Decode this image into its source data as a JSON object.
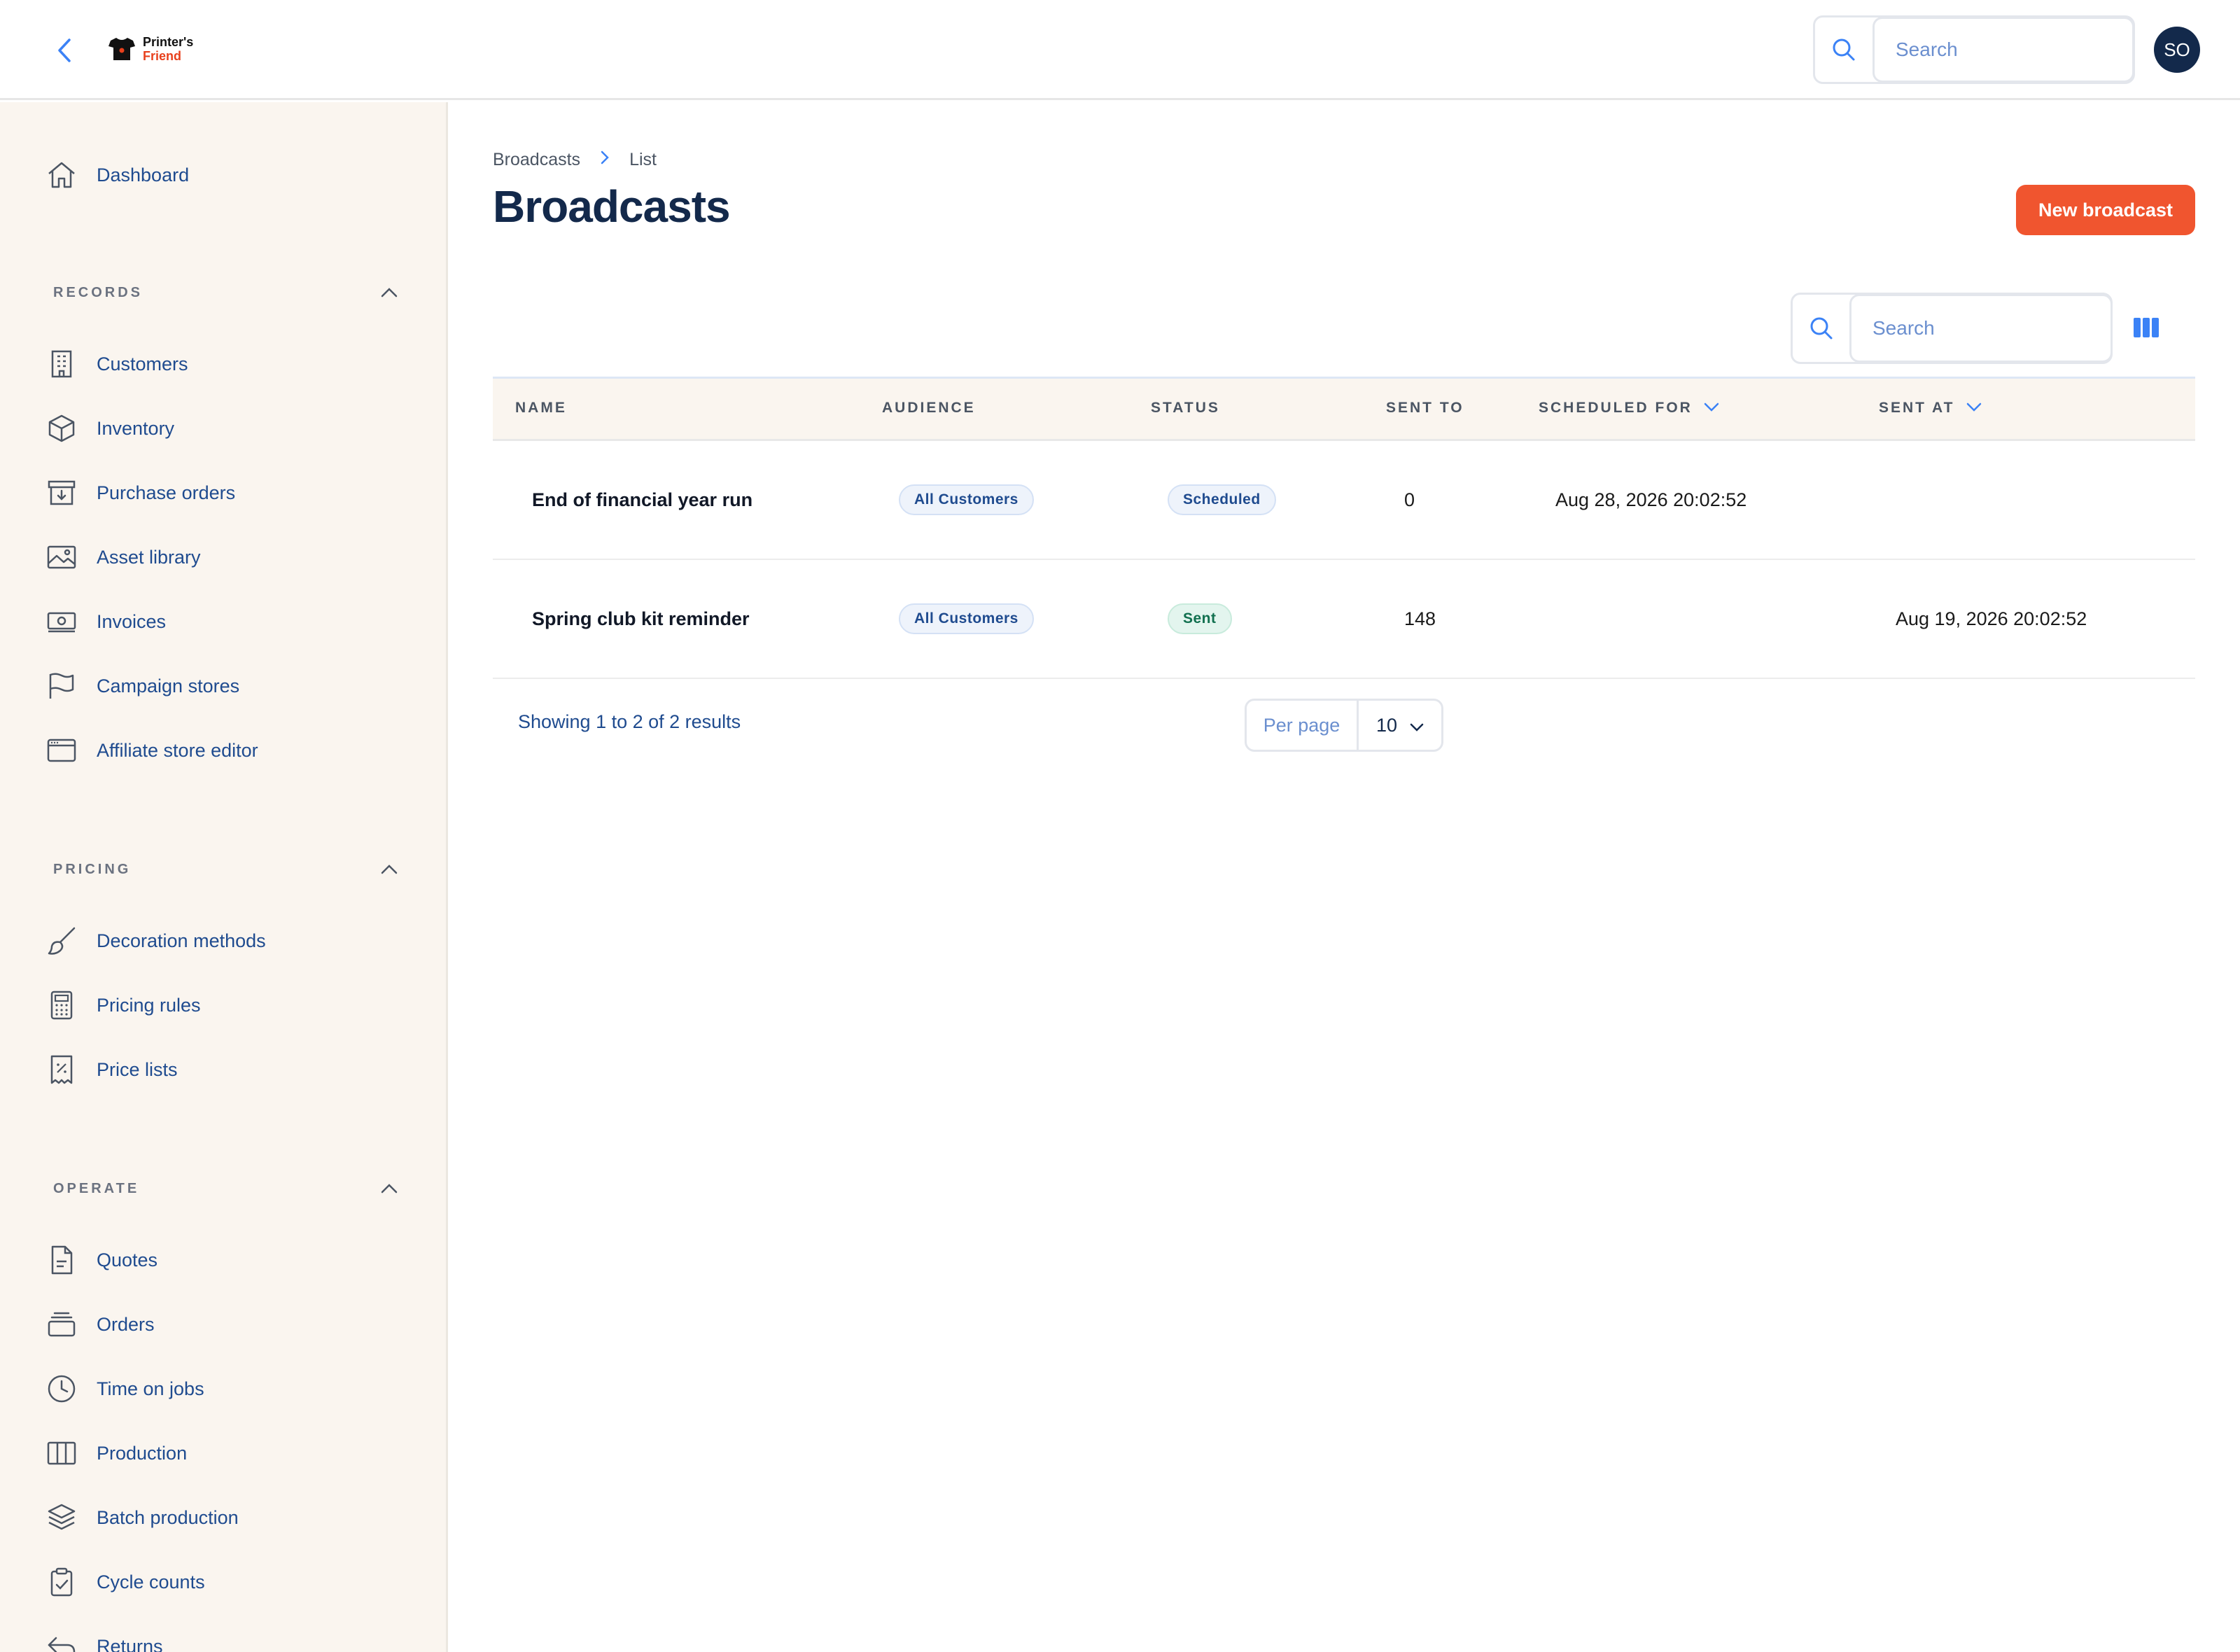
{
  "header": {
    "logo_line1": "Printer's",
    "logo_line2": "Friend",
    "search_placeholder": "Search",
    "avatar_initials": "SO"
  },
  "sidebar": {
    "dashboard": "Dashboard",
    "sections": [
      {
        "label": "RECORDS",
        "items": [
          "Customers",
          "Inventory",
          "Purchase orders",
          "Asset library",
          "Invoices",
          "Campaign stores",
          "Affiliate store editor"
        ]
      },
      {
        "label": "PRICING",
        "items": [
          "Decoration methods",
          "Pricing rules",
          "Price lists"
        ]
      },
      {
        "label": "OPERATE",
        "items": [
          "Quotes",
          "Orders",
          "Time on jobs",
          "Production",
          "Batch production",
          "Cycle counts",
          "Returns"
        ]
      }
    ]
  },
  "breadcrumb": [
    "Broadcasts",
    "List"
  ],
  "page_title": "Broadcasts",
  "new_button": "New broadcast",
  "table_search_placeholder": "Search",
  "table": {
    "columns": [
      "NAME",
      "AUDIENCE",
      "STATUS",
      "SENT TO",
      "SCHEDULED FOR",
      "SENT AT"
    ],
    "rows": [
      {
        "name": "End of financial year run",
        "audience": "All Customers",
        "status": "Scheduled",
        "sent_to": "0",
        "scheduled_for": "Aug 28, 2026 20:02:52",
        "sent_at": ""
      },
      {
        "name": "Spring club kit reminder",
        "audience": "All Customers",
        "status": "Sent",
        "sent_to": "148",
        "scheduled_for": "",
        "sent_at": "Aug 19, 2026 20:02:52"
      }
    ]
  },
  "pagination": {
    "results_text": "Showing 1 to 2 of 2 results",
    "per_page_label": "Per page",
    "per_page_value": "10"
  },
  "colors": {
    "accent": "#f0552f",
    "navy": "#13294b",
    "link": "#1f4b8f",
    "sidebar_bg": "#faf5ef"
  }
}
